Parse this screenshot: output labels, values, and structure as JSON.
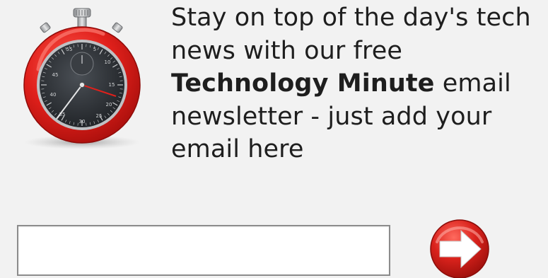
{
  "newsletter": {
    "line1": "Stay on top of the day's tech",
    "line2": "news with our free",
    "brand_name": "Technology Minute",
    "line3_suffix": " email",
    "line4": "newsletter - just add your",
    "line5": "email here"
  },
  "email_input": {
    "value": "",
    "placeholder": ""
  },
  "icons": {
    "stopwatch": "stopwatch-icon",
    "submit": "right-arrow-circle-icon"
  },
  "colors": {
    "background": "#f2f2f2",
    "stopwatch_red": "#e0201b",
    "dial_dark": "#2d3136",
    "arrow_button_red": "#d9221c"
  },
  "stopwatch_dial": {
    "labels": [
      "55",
      "5",
      "10",
      "45",
      "15",
      "40",
      "20",
      "35",
      "25",
      "30"
    ]
  }
}
